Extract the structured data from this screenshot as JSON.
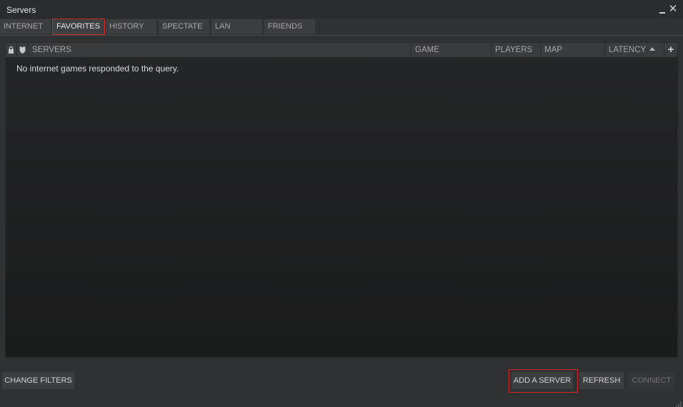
{
  "window": {
    "title": "Servers",
    "minimize_label": "_",
    "close_label": "✕"
  },
  "tabs": [
    {
      "label": "INTERNET",
      "active": false
    },
    {
      "label": "FAVORITES",
      "active": true
    },
    {
      "label": "HISTORY",
      "active": false
    },
    {
      "label": "SPECTATE",
      "active": false
    },
    {
      "label": "LAN",
      "active": false
    },
    {
      "label": "FRIENDS",
      "active": false
    }
  ],
  "table": {
    "icon_columns": [
      "lock-icon",
      "shield-icon"
    ],
    "columns": {
      "servers": "SERVERS",
      "game": "GAME",
      "players": "PLAYERS",
      "map": "MAP",
      "latency": "LATENCY"
    },
    "sort_column": "latency",
    "sort_direction": "ascending",
    "add_column_label": "+",
    "empty_message": "No internet games responded to the query."
  },
  "footer": {
    "change_filters": "CHANGE FILTERS",
    "add_server": "ADD A SERVER",
    "refresh": "REFRESH",
    "connect": "CONNECT"
  },
  "colors": {
    "background": "#303133",
    "panel": "#1f2021",
    "highlight": "#cc2a2a"
  }
}
